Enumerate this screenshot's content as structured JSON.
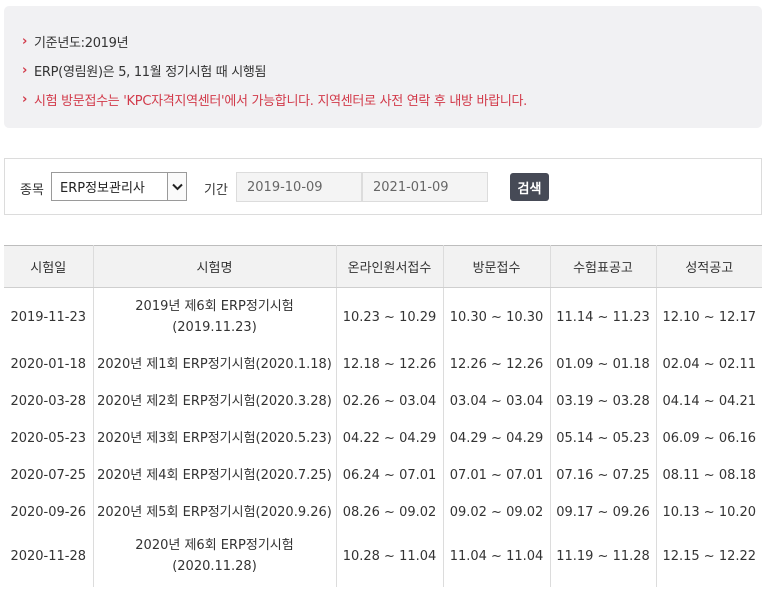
{
  "notices": [
    {
      "text": "기준년도:2019년",
      "highlight": false
    },
    {
      "text": "ERP(영림원)은 5, 11월 정기시험 때 시행됨",
      "highlight": false
    },
    {
      "text": "시험 방문접수는 'KPC자격지역센터'에서 가능합니다. 지역센터로 사전 연락 후 내방 바랍니다.",
      "highlight": true
    }
  ],
  "filter": {
    "category_label": "종목",
    "category_value": "ERP정보관리사",
    "period_label": "기간",
    "start_date": "2019-10-09",
    "end_date": "2021-01-09",
    "search_label": "검색"
  },
  "table": {
    "headers": [
      "시험일",
      "시험명",
      "온라인원서접수",
      "방문접수",
      "수험표공고",
      "성적공고"
    ],
    "rows": [
      {
        "date": "2019-11-23",
        "name1": "2019년 제6회 ERP정기시험",
        "name2": "(2019.11.23)",
        "online": "10.23 ~ 10.29",
        "visit": "10.30 ~ 10.30",
        "ticket": "11.14 ~ 11.23",
        "score": "12.10 ~ 12.17"
      },
      {
        "date": "2020-01-18",
        "name1": "2020년 제1회 ERP정기시험(2020.1.18)",
        "name2": "",
        "online": "12.18 ~ 12.26",
        "visit": "12.26 ~ 12.26",
        "ticket": "01.09 ~ 01.18",
        "score": "02.04 ~ 02.11"
      },
      {
        "date": "2020-03-28",
        "name1": "2020년 제2회 ERP정기시험(2020.3.28)",
        "name2": "",
        "online": "02.26 ~ 03.04",
        "visit": "03.04 ~ 03.04",
        "ticket": "03.19 ~ 03.28",
        "score": "04.14 ~ 04.21"
      },
      {
        "date": "2020-05-23",
        "name1": "2020년 제3회 ERP정기시험(2020.5.23)",
        "name2": "",
        "online": "04.22 ~ 04.29",
        "visit": "04.29 ~ 04.29",
        "ticket": "05.14 ~ 05.23",
        "score": "06.09 ~ 06.16"
      },
      {
        "date": "2020-07-25",
        "name1": "2020년 제4회 ERP정기시험(2020.7.25)",
        "name2": "",
        "online": "06.24 ~ 07.01",
        "visit": "07.01 ~ 07.01",
        "ticket": "07.16 ~ 07.25",
        "score": "08.11 ~ 08.18"
      },
      {
        "date": "2020-09-26",
        "name1": "2020년 제5회 ERP정기시험(2020.9.26)",
        "name2": "",
        "online": "08.26 ~ 09.02",
        "visit": "09.02 ~ 09.02",
        "ticket": "09.17 ~ 09.26",
        "score": "10.13 ~ 10.20"
      },
      {
        "date": "2020-11-28",
        "name1": "2020년 제6회 ERP정기시험",
        "name2": "(2020.11.28)",
        "online": "10.28 ~ 11.04",
        "visit": "11.04 ~ 11.04",
        "ticket": "11.19 ~ 11.28",
        "score": "12.15 ~ 12.22"
      }
    ]
  }
}
